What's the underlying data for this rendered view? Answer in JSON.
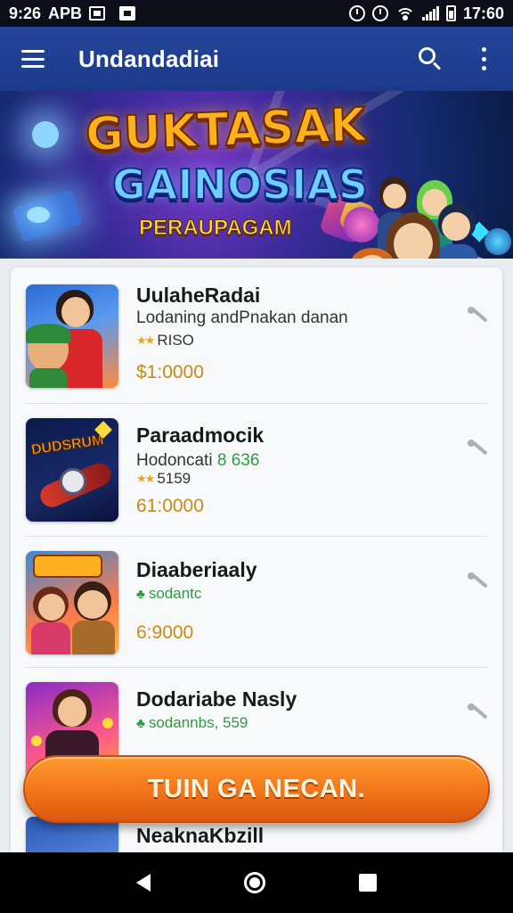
{
  "status_bar": {
    "time_left": "9:26",
    "app_label": "APB",
    "time_right": "17:60"
  },
  "app_bar": {
    "title": "Undandadiai",
    "icons": [
      "menu-icon",
      "search-icon",
      "more-vert-icon"
    ]
  },
  "banner": {
    "title_line1": "GUKTASAK",
    "title_line2": "GAINOSIAS",
    "subtitle": "PERAUPAGAM"
  },
  "list": {
    "items": [
      {
        "title": "UulaheRadai",
        "subtitle": "Lodaning andPnakan danan",
        "rating_icon": "stars-icon",
        "rating_text": "RISO",
        "price": "$1:0000"
      },
      {
        "title": "Paraadmocik",
        "subtitle": "Hodoncati",
        "subtitle_accent": "8 636",
        "rating_icon": "stars-icon",
        "rating_text": "5159",
        "price": "61:0000"
      },
      {
        "title": "Diaaberiaaly",
        "subtitle": "",
        "rating_icon": "leaf-icon",
        "rating_text": "sodantc",
        "price": "6:9000"
      },
      {
        "title": "Dodariabe Nasly",
        "subtitle": "",
        "rating_icon": "leaf-icon",
        "rating_text": "sodannbs, 559",
        "price": ""
      },
      {
        "title": "NeaknaKbzill",
        "subtitle": "",
        "rating_text": "",
        "price": ""
      }
    ]
  },
  "cta": {
    "label": "TUIN GA NECAN."
  },
  "nav_bar": {
    "icons": [
      "back-icon",
      "home-icon",
      "recents-icon"
    ]
  },
  "colors": {
    "app_bar": "#1b3a8a",
    "cta": "#f2741a",
    "price": "#c88a16",
    "accent_green": "#2e9b3f"
  }
}
